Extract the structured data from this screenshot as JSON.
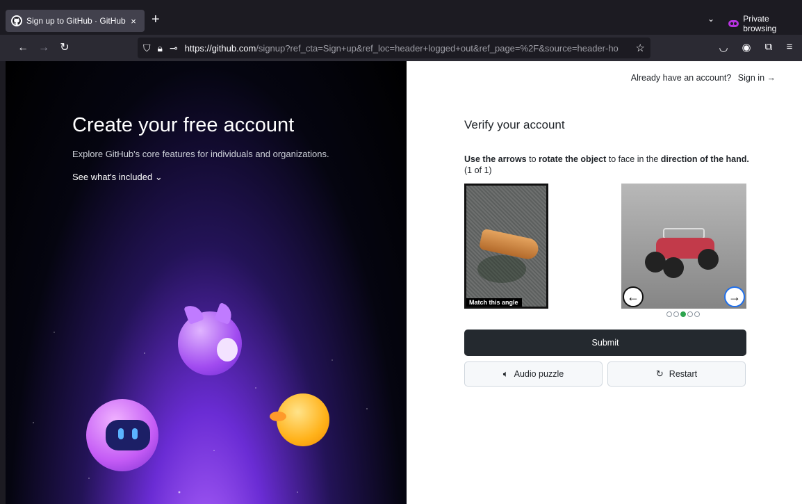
{
  "browser": {
    "tab_title": "Sign up to GitHub · GitHub",
    "tab_close": "×",
    "new_tab": "+",
    "private_label": "Private browsing",
    "url_domain": "https://github.com",
    "url_path": "/signup?ref_cta=Sign+up&ref_loc=header+logged+out&ref_page=%2F&source=header-ho",
    "icons": [
      "back-icon",
      "forward-icon",
      "reload-icon",
      "shield-icon",
      "lock-icon",
      "key-icon",
      "star-icon",
      "pocket-icon",
      "account-icon",
      "extensions-icon",
      "menu-icon"
    ]
  },
  "left_panel": {
    "heading": "Create your free account",
    "subheading": "Explore GitHub's core features for individuals and organizations.",
    "included_link": "See what's included",
    "included_chevron": "⌄"
  },
  "right_panel": {
    "signin_prompt": "Already have an account?",
    "signin_link": "Sign in →",
    "title": "Verify your account",
    "instruction_parts": {
      "a": "Use the arrows",
      "b": " to ",
      "c": "rotate the object",
      "d": " to face in the ",
      "e": "direction of the hand.",
      "f": " (1 of 1)"
    },
    "match_label": "Match this angle",
    "carousel": {
      "total": 5,
      "active_index": 2
    },
    "submit_label": "Submit",
    "audio_label": "Audio puzzle",
    "restart_label": "Restart"
  }
}
